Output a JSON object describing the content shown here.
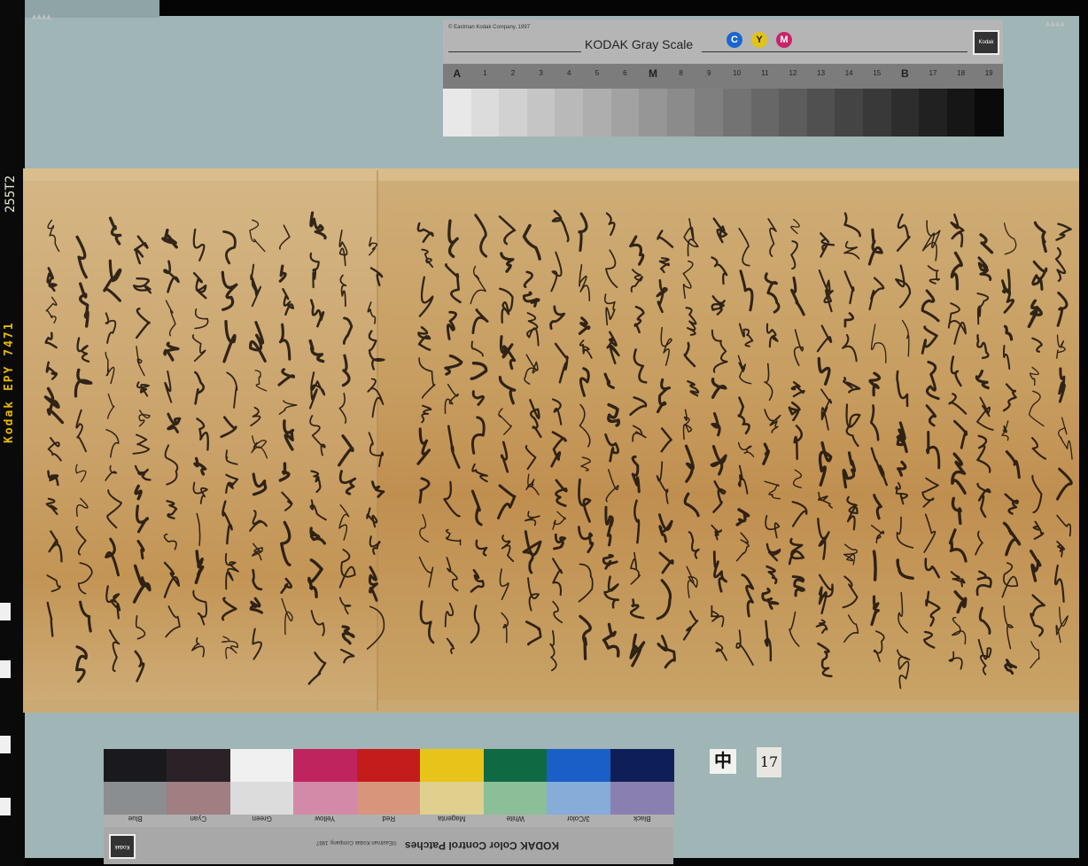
{
  "film": {
    "edge_code": "Kodak EPY 7471",
    "edge_number": "255T2"
  },
  "gray_scale": {
    "copyright": "© Eastman Kodak Company, 1997",
    "title": "KODAK Gray Scale",
    "cym": [
      "C",
      "Y",
      "M"
    ],
    "logo": "Kodak",
    "steps": [
      "A",
      "1",
      "2",
      "3",
      "4",
      "5",
      "6",
      "M",
      "8",
      "9",
      "10",
      "11",
      "12",
      "13",
      "14",
      "15",
      "B",
      "17",
      "18",
      "19"
    ]
  },
  "color_patches": {
    "title": "KODAK Color Control Patches",
    "copyright": "©Eastman Kodak Company, 1997",
    "logo": "Kodak",
    "labels": [
      "Black",
      "3/Color",
      "White",
      "Magenta",
      "Red",
      "Yellow",
      "Green",
      "Cyan",
      "Blue"
    ],
    "top_colors": [
      "#1a1a1e",
      "#2a2226",
      "#f0f0f0",
      "#c0245e",
      "#c41c1c",
      "#e6c41a",
      "#0f6a44",
      "#1a5ec8",
      "#0e1e56"
    ],
    "bottom_colors": [
      "#8a8e90",
      "#a07e82",
      "#dcdcdc",
      "#d28aa8",
      "#d8957c",
      "#e0d08e",
      "#8abf98",
      "#86acd8",
      "#8a80b0"
    ]
  },
  "labels": {
    "volume_mark": "中",
    "plate_number": "17"
  }
}
